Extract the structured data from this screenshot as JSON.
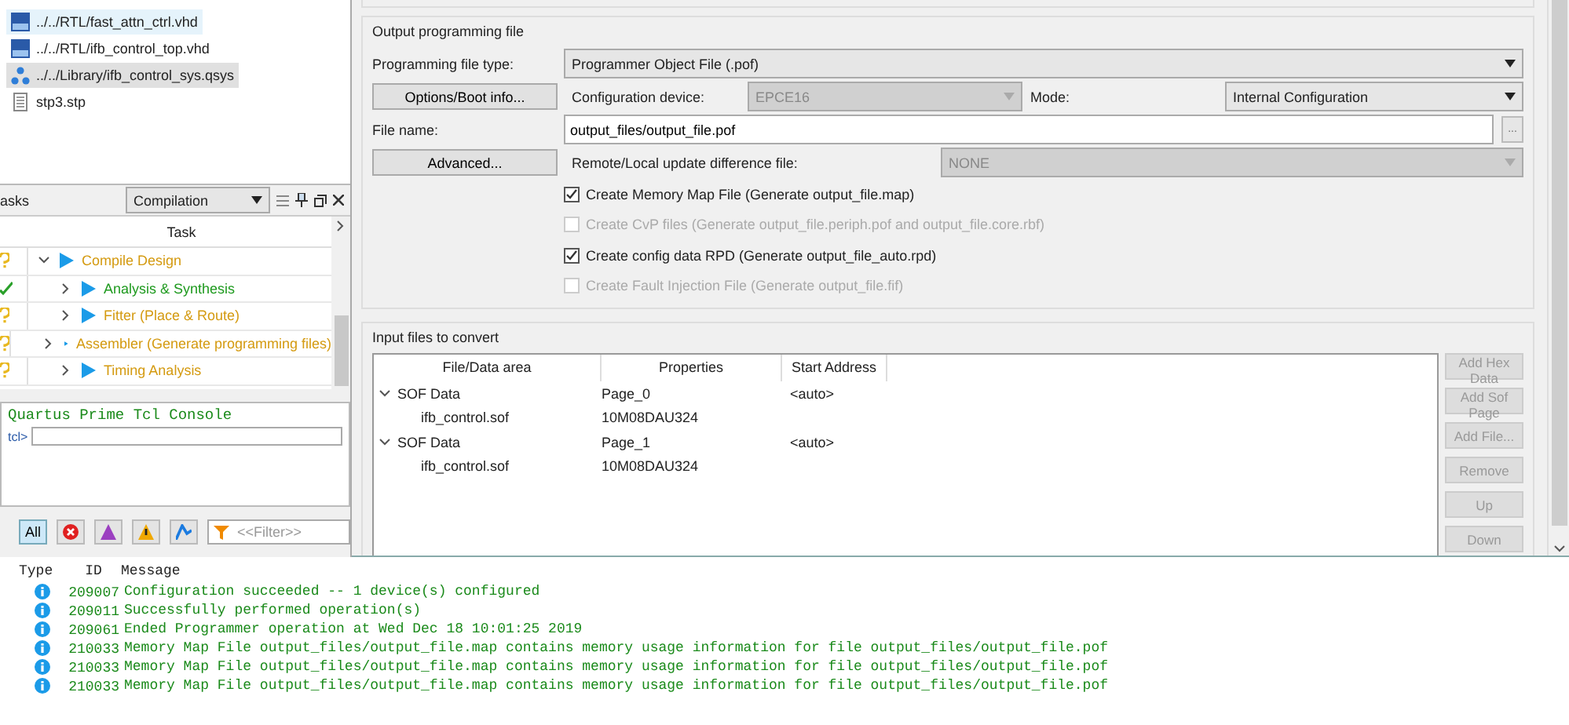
{
  "files": [
    {
      "kind": "vhd",
      "name": "../../RTL/fast_attn_ctrl.vhd",
      "selected": false,
      "hover": true
    },
    {
      "kind": "vhd",
      "name": "../../RTL/ifb_control_top.vhd",
      "selected": false,
      "hover": false
    },
    {
      "kind": "qsys",
      "name": "../../Library/ifb_control_sys.qsys",
      "selected": true,
      "hover": false
    },
    {
      "kind": "text",
      "name": "stp3.stp",
      "selected": false,
      "hover": false
    }
  ],
  "tasks_panel": {
    "title": "asks",
    "flow": "Compilation",
    "column": "Task",
    "tasks": [
      {
        "name": "Compile Design",
        "kind": "pending",
        "expanded": true,
        "children": [
          {
            "name": "Analysis & Synthesis",
            "kind": "done",
            "expanded": false
          },
          {
            "name": "Fitter (Place & Route)",
            "kind": "pending",
            "expanded": false
          },
          {
            "name": "Assembler (Generate programming files)",
            "kind": "pending",
            "expanded": false
          },
          {
            "name": "Timing Analysis",
            "kind": "pending",
            "expanded": false
          }
        ]
      }
    ]
  },
  "tcl_console": {
    "title": "Quartus Prime Tcl Console",
    "prompt": "tcl>"
  },
  "message_toolbar": {
    "all_label": "All",
    "all_selected": true,
    "filter_placeholder": "<<Filter>>"
  },
  "dialog": {
    "output_group": {
      "title": "Output programming file",
      "file_type_label": "Programming file type:",
      "file_type": "Programmer Object File (.pof)",
      "options_button": "Options/Boot info...",
      "device_label": "Configuration device:",
      "device": "EPCE16",
      "device_disabled": true,
      "mode_label": "Mode:",
      "mode": "Internal Configuration",
      "file_name_label": "File name:",
      "file_name": "output_files/output_file.pof",
      "browse_button": "...",
      "advanced_button": "Advanced...",
      "remote_label": "Remote/Local update difference file:",
      "remote": "NONE",
      "remote_disabled": true,
      "options": [
        {
          "label": "Create Memory Map File (Generate output_file.map)",
          "checked": true,
          "disabled": false
        },
        {
          "label": "Create CvP files (Generate output_file.periph.pof and output_file.core.rbf)",
          "checked": false,
          "disabled": true
        },
        {
          "label": "Create config data RPD (Generate output_file_auto.rpd)",
          "checked": true,
          "disabled": false
        },
        {
          "label": "Create Fault Injection File (Generate output_file.fif)",
          "checked": false,
          "disabled": true
        }
      ]
    },
    "input_group": {
      "title": "Input files to convert",
      "columns": [
        "File/Data area",
        "Properties",
        "Start Address"
      ],
      "rows": [
        {
          "name": "SOF Data",
          "properties": "Page_0",
          "address": "<auto>",
          "expanded": true,
          "children": [
            {
              "name": "ifb_control.sof",
              "properties": "10M08DAU324"
            }
          ]
        },
        {
          "name": "SOF Data",
          "properties": "Page_1",
          "address": "<auto>",
          "expanded": true,
          "children": [
            {
              "name": "ifb_control.sof",
              "properties": "10M08DAU324"
            }
          ]
        }
      ],
      "buttons": [
        {
          "label": "Add Hex Data",
          "disabled": true
        },
        {
          "label": "Add Sof Page",
          "disabled": true
        },
        {
          "label": "Add File...",
          "disabled": true
        },
        {
          "label": "Remove",
          "disabled": true
        },
        {
          "label": "Up",
          "disabled": true
        },
        {
          "label": "Down",
          "disabled": true
        }
      ]
    }
  },
  "messages": {
    "columns": [
      "Type",
      "ID",
      "Message"
    ],
    "rows": [
      {
        "kind": "info",
        "id": "209007",
        "text": "Configuration succeeded -- 1 device(s) configured"
      },
      {
        "kind": "info",
        "id": "209011",
        "text": "Successfully performed operation(s)"
      },
      {
        "kind": "info",
        "id": "209061",
        "text": "Ended Programmer operation at Wed Dec 18 10:01:25 2019"
      },
      {
        "kind": "info",
        "id": "210033",
        "text": "Memory Map File output_files/output_file.map contains memory usage information for file output_files/output_file.pof"
      },
      {
        "kind": "info",
        "id": "210033",
        "text": "Memory Map File output_files/output_file.map contains memory usage information for file output_files/output_file.pof"
      },
      {
        "kind": "info",
        "id": "210033",
        "text": "Memory Map File output_files/output_file.map contains memory usage information for file output_files/output_file.pof"
      }
    ]
  }
}
